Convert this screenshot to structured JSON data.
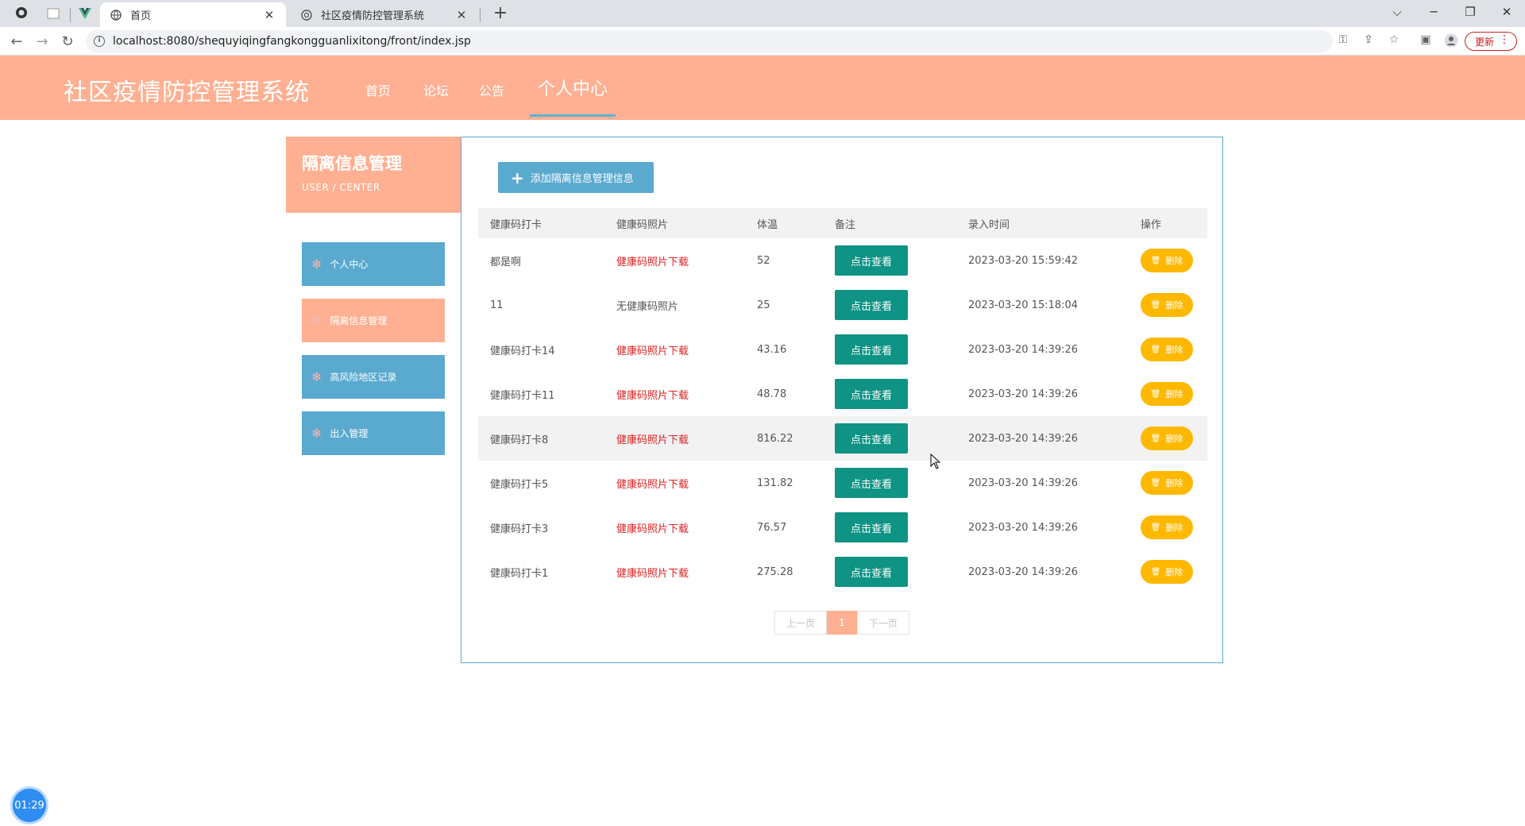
{
  "browser": {
    "tabs": [
      {
        "title": "首页",
        "active": true
      },
      {
        "title": "社区疫情防控管理系统",
        "active": false
      }
    ],
    "url": "localhost:8080/shequyiqingfangkongguanlixitong/front/index.jsp",
    "update_label": "更新"
  },
  "site": {
    "title": "社区疫情防控管理系统",
    "nav": [
      "首页",
      "论坛",
      "公告",
      "个人中心"
    ],
    "active_nav": "个人中心"
  },
  "sidebar": {
    "heading": "隔离信息管理",
    "subheading": "USER / CENTER",
    "items": [
      "个人中心",
      "隔离信息管理",
      "高风险地区记录",
      "出入管理"
    ],
    "active_item": "隔离信息管理"
  },
  "main": {
    "add_button": "添加隔离信息管理信息",
    "columns": [
      "健康码打卡",
      "健康码照片",
      "体温",
      "备注",
      "录入时间",
      "操作"
    ],
    "view_label": "点击查看",
    "delete_label": "删除",
    "rows": [
      {
        "name": "都是啊",
        "photo": "健康码照片下载",
        "photo_link": true,
        "temp": "52",
        "time": "2023-03-20 15:59:42"
      },
      {
        "name": "11",
        "photo": "无健康码照片",
        "photo_link": false,
        "temp": "25",
        "time": "2023-03-20 15:18:04"
      },
      {
        "name": "健康码打卡14",
        "photo": "健康码照片下载",
        "photo_link": true,
        "temp": "43.16",
        "time": "2023-03-20 14:39:26"
      },
      {
        "name": "健康码打卡11",
        "photo": "健康码照片下载",
        "photo_link": true,
        "temp": "48.78",
        "time": "2023-03-20 14:39:26"
      },
      {
        "name": "健康码打卡8",
        "photo": "健康码照片下载",
        "photo_link": true,
        "temp": "816.22",
        "time": "2023-03-20 14:39:26"
      },
      {
        "name": "健康码打卡5",
        "photo": "健康码照片下载",
        "photo_link": true,
        "temp": "131.82",
        "time": "2023-03-20 14:39:26"
      },
      {
        "name": "健康码打卡3",
        "photo": "健康码照片下载",
        "photo_link": true,
        "temp": "76.57",
        "time": "2023-03-20 14:39:26"
      },
      {
        "name": "健康码打卡1",
        "photo": "健康码照片下载",
        "photo_link": true,
        "temp": "275.28",
        "time": "2023-03-20 14:39:26"
      }
    ],
    "pagination": {
      "prev": "上一页",
      "current": "1",
      "next": "下一页"
    }
  },
  "timer": "01:29",
  "colors": {
    "header": "#ffb092",
    "sidebar_item": "#5aa9cf",
    "view_button": "#0e9384",
    "delete_button": "#ffb800",
    "download_link": "#e02020"
  }
}
